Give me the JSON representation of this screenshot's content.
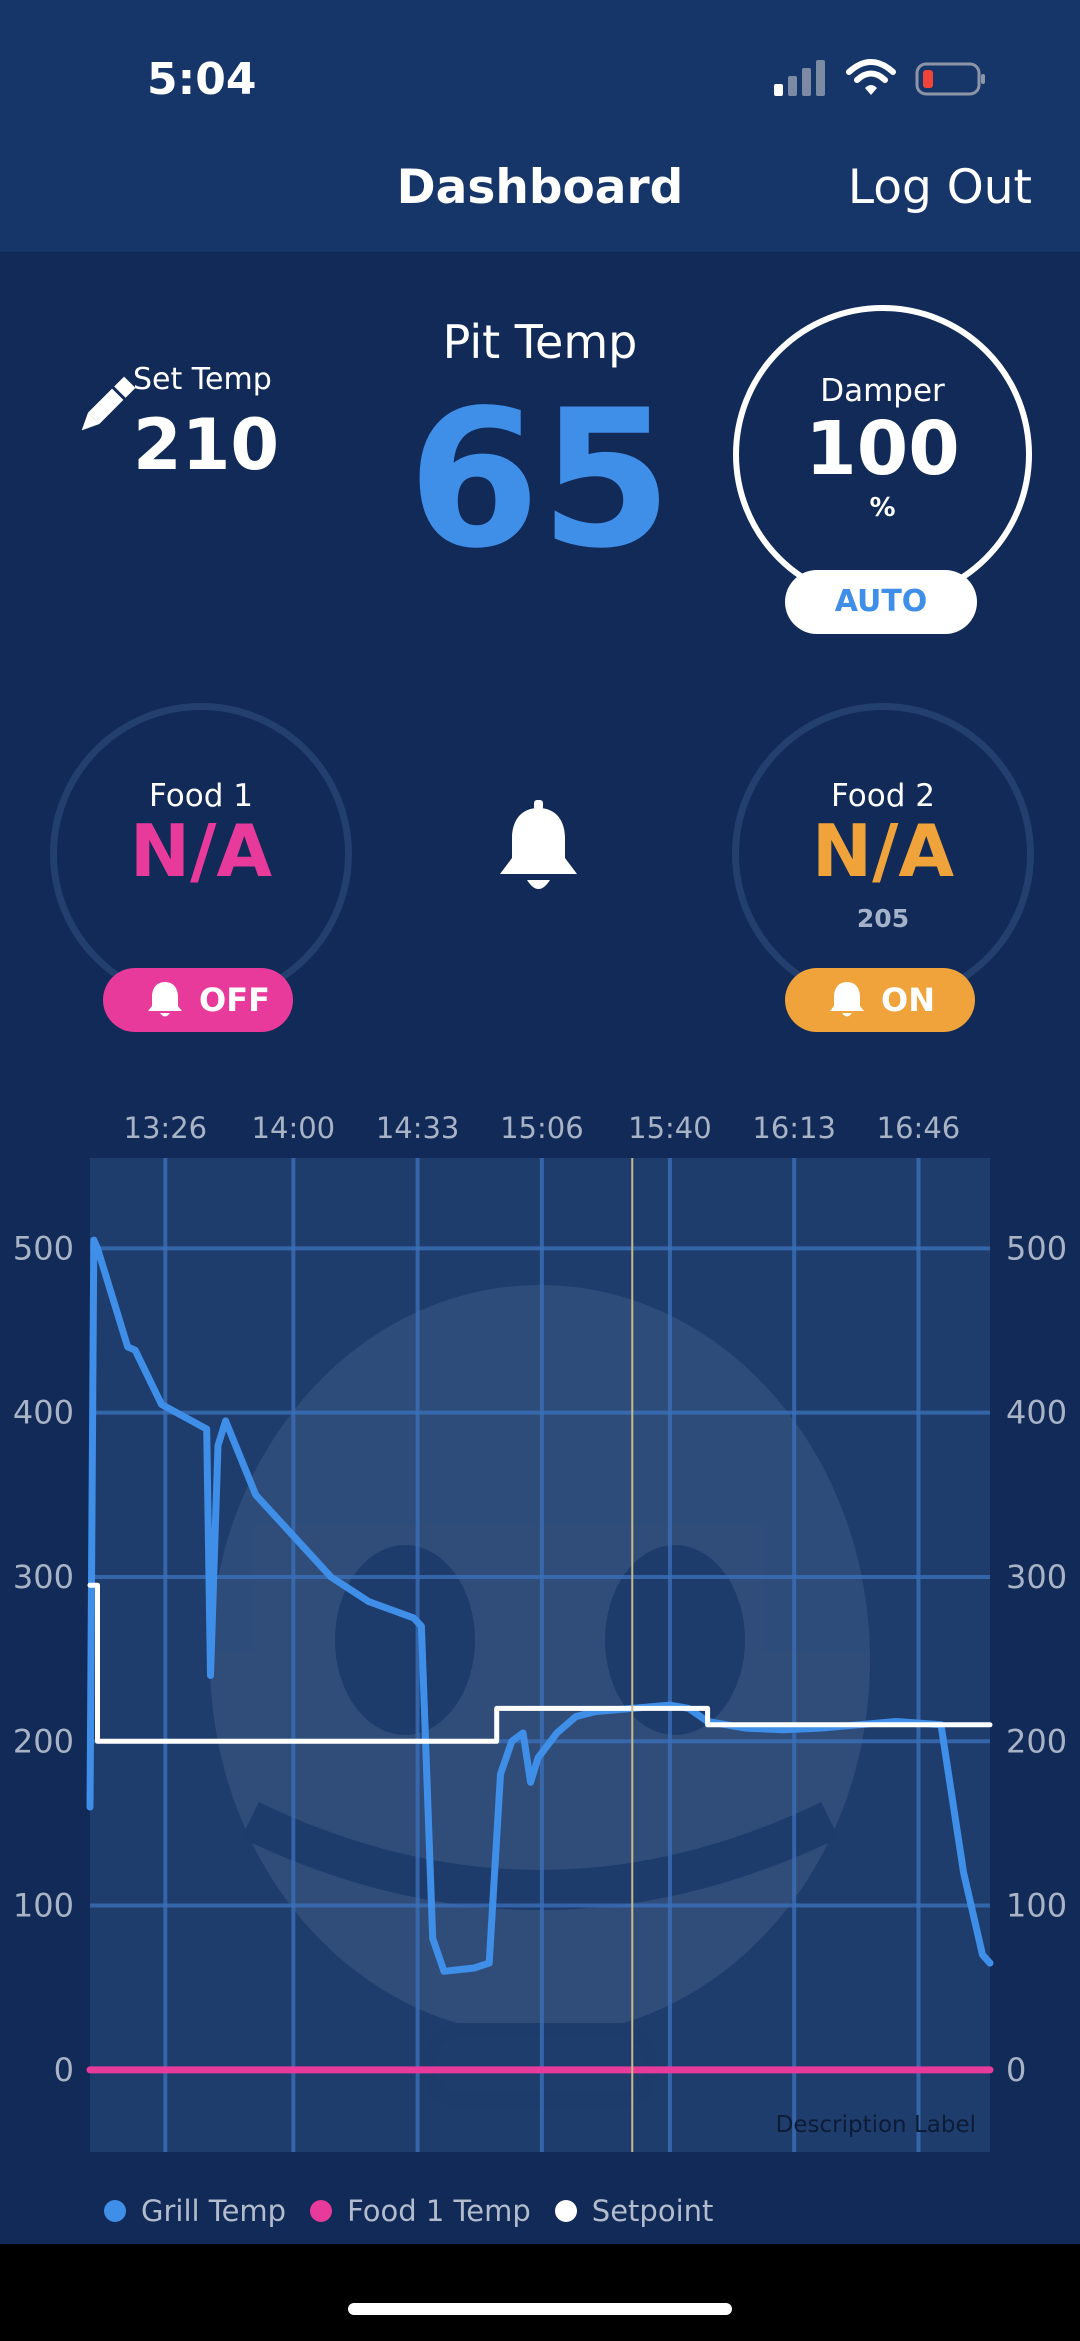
{
  "status_bar": {
    "time": "5:04"
  },
  "nav": {
    "title": "Dashboard",
    "logout_label": "Log Out"
  },
  "set_temp": {
    "label": "Set Temp",
    "value": "210"
  },
  "pit_temp": {
    "label": "Pit Temp",
    "value": "65"
  },
  "damper": {
    "label": "Damper",
    "value": "100",
    "unit": "%",
    "mode_label": "AUTO"
  },
  "food1": {
    "label": "Food 1",
    "value": "N/A",
    "alarm_label": "OFF",
    "color": "#e83a9b"
  },
  "food2": {
    "label": "Food  2",
    "value": "N/A",
    "target": "205",
    "alarm_label": "ON",
    "color": "#f0a33a"
  },
  "colors": {
    "grill": "#3f8ee8",
    "food1": "#e83a9b",
    "setpoint": "#ffffff",
    "accent_orange": "#f0a33a"
  },
  "chart_data": {
    "type": "line",
    "x_ticks": [
      "13:26",
      "14:00",
      "14:33",
      "15:06",
      "15:40",
      "16:13",
      "16:46"
    ],
    "y_ticks": [
      0,
      100,
      200,
      300,
      400,
      500
    ],
    "ylim": [
      -50,
      555
    ],
    "xlim": [
      "13:06",
      "17:05"
    ],
    "grid": true,
    "legend_position": "bottom",
    "cursor_time": "15:30",
    "annotation": "Description Label",
    "series": [
      {
        "name": "Grill Temp",
        "color": "#3f8ee8",
        "points": [
          [
            "13:06",
            160
          ],
          [
            "13:07",
            505
          ],
          [
            "13:08",
            500
          ],
          [
            "13:12",
            470
          ],
          [
            "13:16",
            440
          ],
          [
            "13:18",
            438
          ],
          [
            "13:25",
            405
          ],
          [
            "13:37",
            390
          ],
          [
            "13:38",
            240
          ],
          [
            "13:40",
            380
          ],
          [
            "13:42",
            395
          ],
          [
            "13:50",
            350
          ],
          [
            "14:00",
            325
          ],
          [
            "14:10",
            300
          ],
          [
            "14:20",
            285
          ],
          [
            "14:32",
            275
          ],
          [
            "14:34",
            270
          ],
          [
            "14:37",
            80
          ],
          [
            "14:40",
            60
          ],
          [
            "14:48",
            62
          ],
          [
            "14:52",
            65
          ],
          [
            "14:55",
            180
          ],
          [
            "14:58",
            200
          ],
          [
            "15:01",
            205
          ],
          [
            "15:03",
            175
          ],
          [
            "15:05",
            190
          ],
          [
            "15:10",
            205
          ],
          [
            "15:15",
            215
          ],
          [
            "15:20",
            218
          ],
          [
            "15:30",
            220
          ],
          [
            "15:40",
            222
          ],
          [
            "15:45",
            220
          ],
          [
            "15:50",
            212
          ],
          [
            "16:00",
            208
          ],
          [
            "16:10",
            207
          ],
          [
            "16:20",
            208
          ],
          [
            "16:30",
            210
          ],
          [
            "16:40",
            212
          ],
          [
            "16:52",
            210
          ],
          [
            "16:58",
            120
          ],
          [
            "17:03",
            70
          ],
          [
            "17:05",
            65
          ]
        ]
      },
      {
        "name": "Food 1 Temp",
        "color": "#e83a9b",
        "points": [
          [
            "13:06",
            0
          ],
          [
            "17:05",
            0
          ]
        ]
      },
      {
        "name": "Setpoint",
        "color": "#ffffff",
        "points": [
          [
            "13:06",
            295
          ],
          [
            "13:08",
            295
          ],
          [
            "13:08",
            200
          ],
          [
            "14:54",
            200
          ],
          [
            "14:54",
            220
          ],
          [
            "15:50",
            220
          ],
          [
            "15:50",
            210
          ],
          [
            "17:05",
            210
          ]
        ]
      }
    ]
  }
}
